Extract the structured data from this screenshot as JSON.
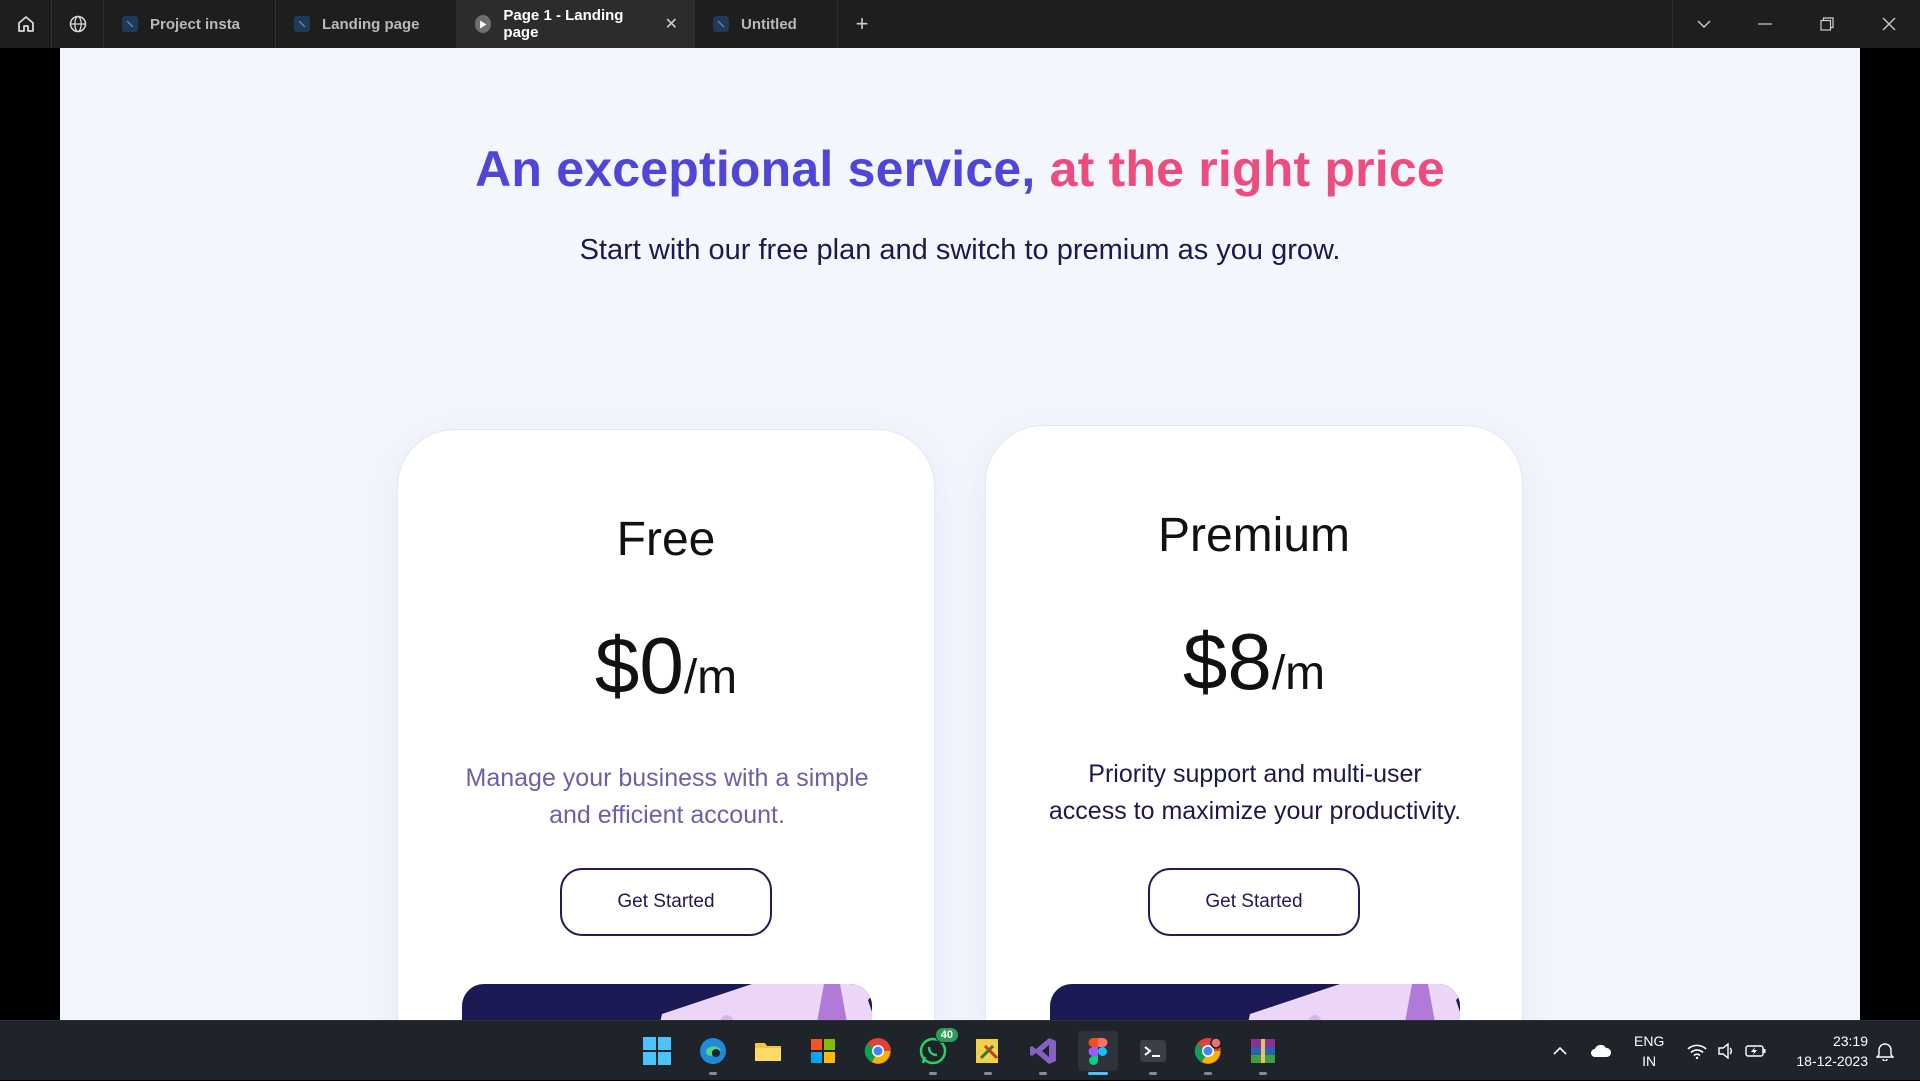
{
  "tabs": [
    {
      "label": "Project insta",
      "active": false,
      "icon": "figma-file-icon"
    },
    {
      "label": "Landing page",
      "active": false,
      "icon": "figma-file-icon"
    },
    {
      "label": "Page 1 - Landing page",
      "active": true,
      "icon": "play-icon"
    },
    {
      "label": "Untitled",
      "active": false,
      "icon": "figma-file-icon"
    }
  ],
  "page": {
    "headline_part1": "An exceptional service,",
    "headline_part2": "at the right price",
    "subtitle": "Start with our free plan and switch to premium as you grow."
  },
  "plans": {
    "free": {
      "name": "Free",
      "price": "$0",
      "period": "/m",
      "description": "Manage your business with a simple and efficient account.",
      "cta": "Get Started"
    },
    "premium": {
      "name": "Premium",
      "price": "$8",
      "period": "/m",
      "description": "Priority support and multi-user access to maximize your productivity.",
      "cta": "Get Started"
    }
  },
  "taskbar": {
    "apps": [
      "windows-start",
      "edge",
      "file-explorer",
      "microsoft-store",
      "chrome",
      "whatsapp",
      "sticky-tools",
      "visual-studio",
      "figma",
      "terminal",
      "chrome-profile",
      "winrar"
    ],
    "whatsapp_badge": "40",
    "lang_line1": "ENG",
    "lang_line2": "IN",
    "time": "23:19",
    "date": "18-12-2023"
  },
  "colors": {
    "headline_blue": "#4f46d8",
    "headline_pink": "#ec4d7e",
    "navy": "#1d1a55",
    "frame_bg": "#f3f6fd"
  }
}
